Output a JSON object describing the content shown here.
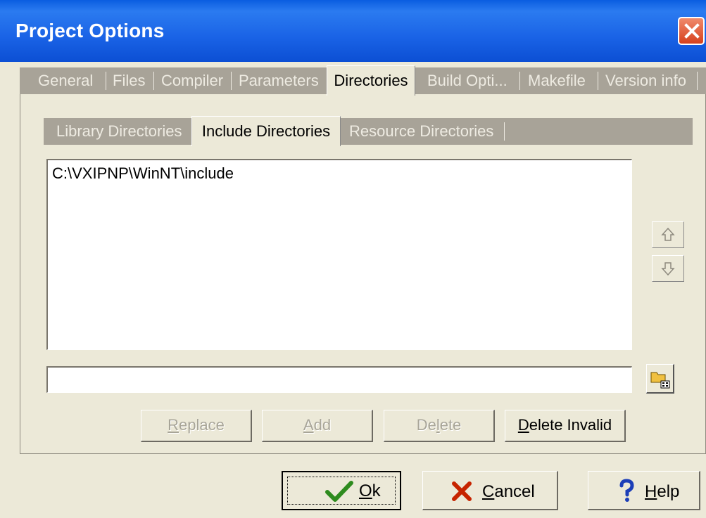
{
  "window": {
    "title": "Project Options"
  },
  "tabs": [
    {
      "label": "General"
    },
    {
      "label": "Files"
    },
    {
      "label": "Compiler"
    },
    {
      "label": "Parameters"
    },
    {
      "label": "Directories"
    },
    {
      "label": "Build Opti..."
    },
    {
      "label": "Makefile"
    },
    {
      "label": "Version info"
    }
  ],
  "subtabs": [
    {
      "label": "Library Directories"
    },
    {
      "label": "Include Directories"
    },
    {
      "label": "Resource Directories"
    }
  ],
  "directory_list": {
    "items": [
      "C:\\VXIPNP\\WinNT\\include"
    ]
  },
  "path_input": {
    "value": ""
  },
  "actions": {
    "replace": {
      "first": "R",
      "rest": "eplace"
    },
    "add": {
      "first": "A",
      "rest": "dd"
    },
    "delete": {
      "pre": "De",
      "ul": "l",
      "post": "ete"
    },
    "delete_invalid": {
      "first": "D",
      "rest": "elete Invalid"
    }
  },
  "dialog_buttons": {
    "ok": {
      "first": "O",
      "rest": "k"
    },
    "cancel": {
      "first": "C",
      "rest": "ancel"
    },
    "help": {
      "first": "H",
      "rest": "elp"
    }
  },
  "colors": {
    "title_bar": "#1a63e6",
    "tab_strip": "#a8a398",
    "dialog_bg": "#ece9d8"
  }
}
